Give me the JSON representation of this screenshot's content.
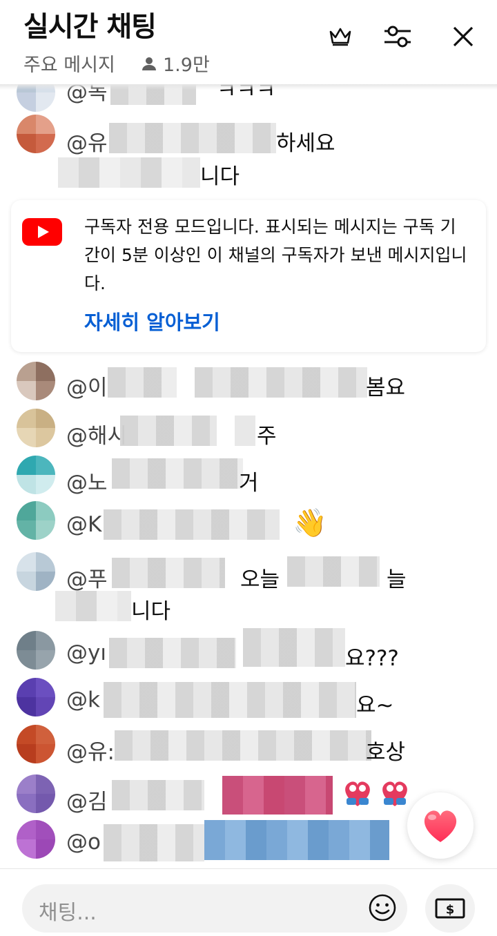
{
  "header": {
    "title": "실시간 채팅",
    "mode": "주요 메시지",
    "viewer_count": "1.9만"
  },
  "icons": {
    "crown": "crown-icon",
    "filter": "sliders-icon",
    "close": "close-icon",
    "person": "person-icon",
    "youtube": "youtube-logo",
    "emoji": "emoji-smile-icon",
    "super_chat": "dollar-bill-icon",
    "heart": "heart-icon"
  },
  "colors": {
    "link": "#065fd4",
    "youtube_red": "#ff0000",
    "heart": "#ff4d6d"
  },
  "messages_top": [
    {
      "author": "@독",
      "text": "ㅋㅋㅋ"
    },
    {
      "author": "@유",
      "text": "하세요",
      "text2": "니다"
    }
  ],
  "notice": {
    "text": "구독자 전용 모드입니다. 표시되는 메시지는 구독 기간이 5분 이상인 이 채널의 구독자가 보낸 메시지입니다.",
    "link": "자세히 알아보기"
  },
  "messages": [
    {
      "author": "@이",
      "text": "봄요"
    },
    {
      "author": "@해시",
      "text": "주"
    },
    {
      "author": "@노",
      "text": "거"
    },
    {
      "author": "@K",
      "text": "👋"
    },
    {
      "author": "@푸",
      "text": "오늘",
      "text_end": "늘",
      "text2": "니다"
    },
    {
      "author": "@yı",
      "text": "요???"
    },
    {
      "author": "@k",
      "text": "요~"
    },
    {
      "author": "@유:",
      "text": "호상"
    },
    {
      "author": "@김",
      "text": ""
    },
    {
      "author": "@o",
      "text": ""
    }
  ],
  "composer": {
    "placeholder": "채팅..."
  }
}
